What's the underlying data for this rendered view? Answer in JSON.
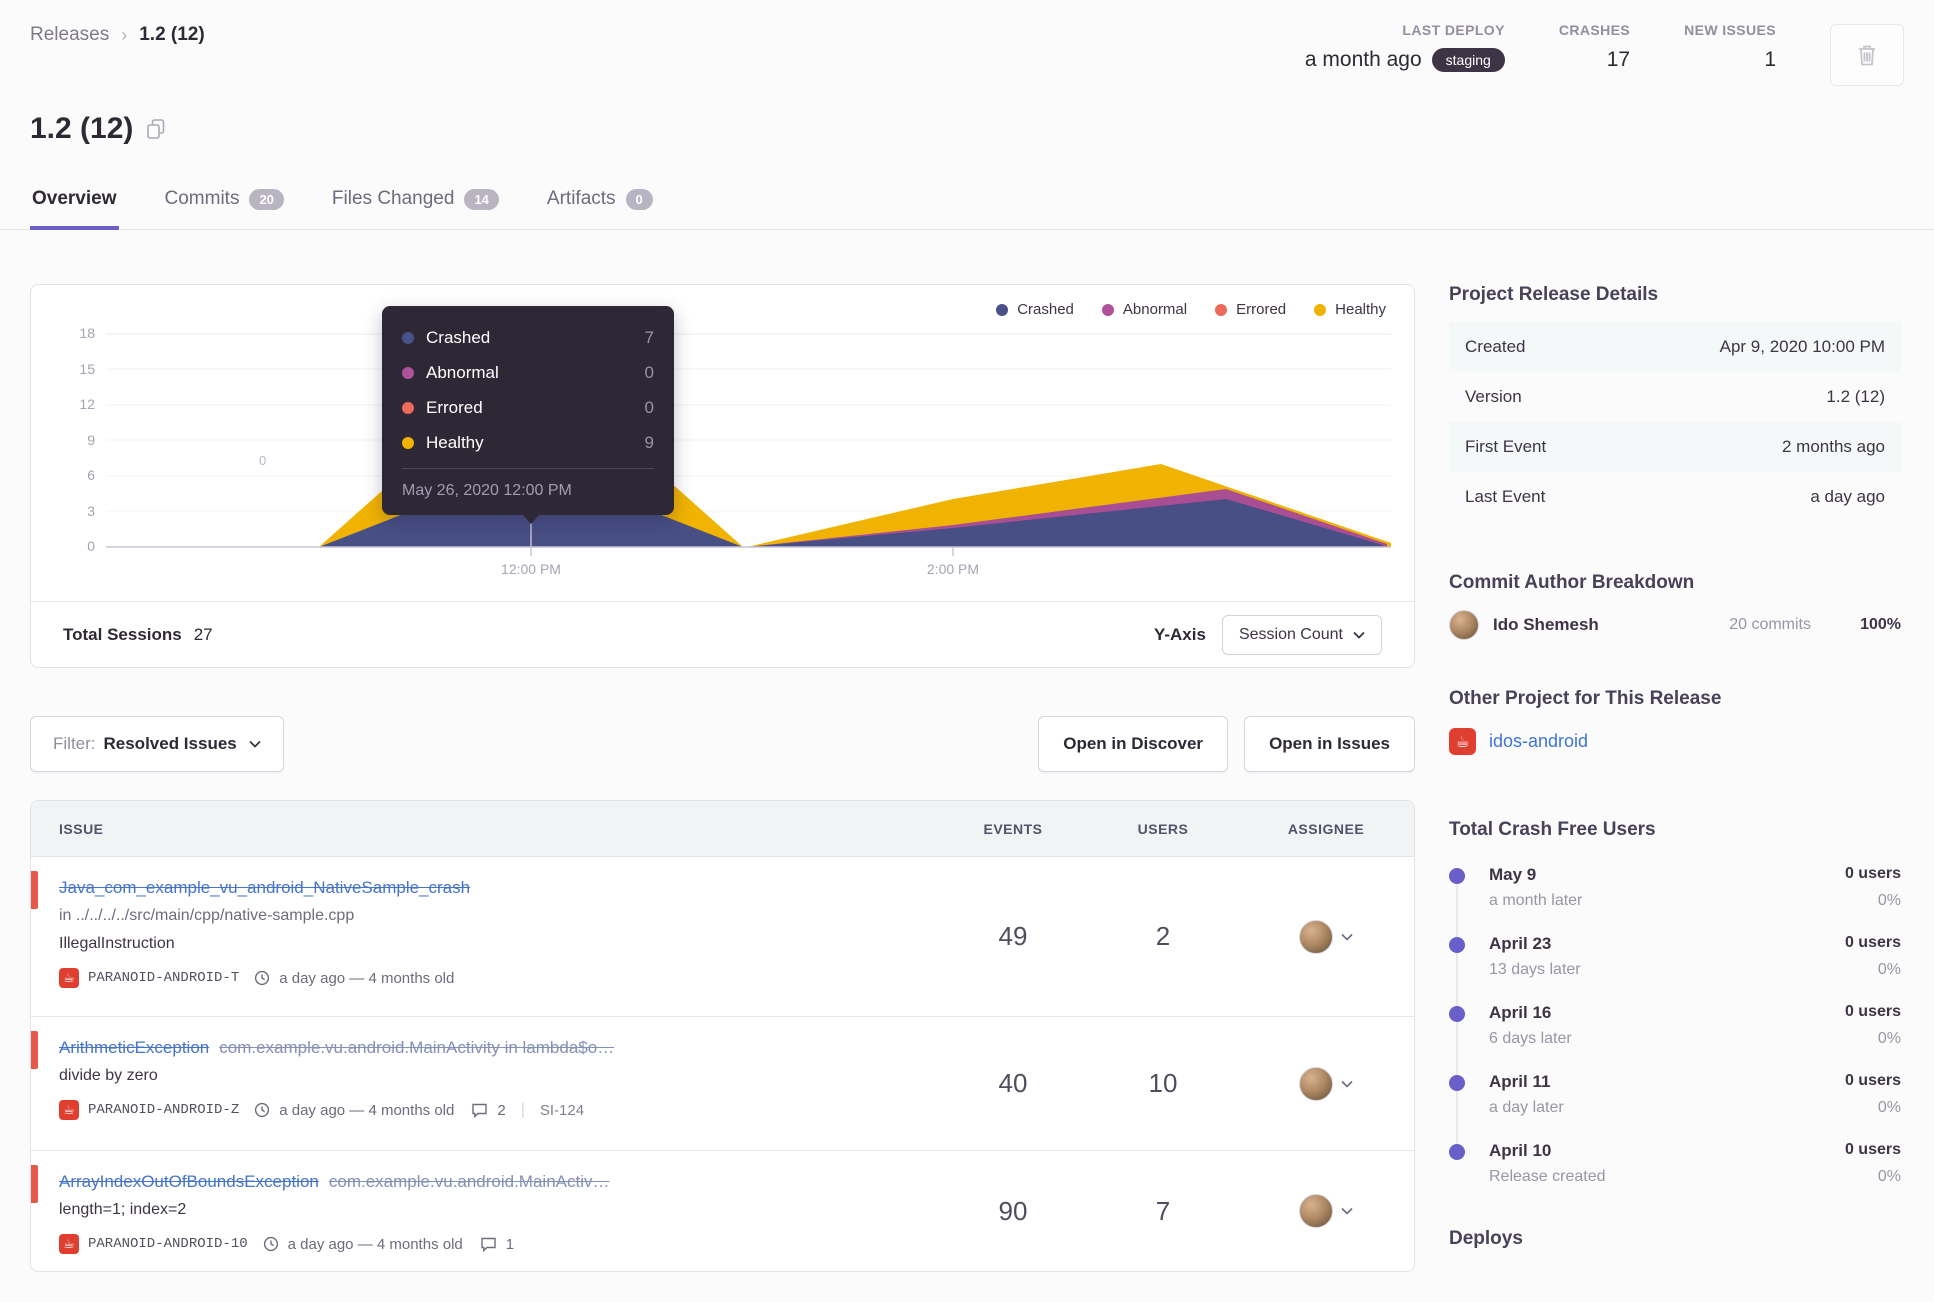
{
  "accent_color": "#6c5fc7",
  "breadcrumb": {
    "parent": "Releases",
    "current": "1.2 (12)"
  },
  "topstats": {
    "last_deploy": {
      "label": "LAST DEPLOY",
      "value": "a month ago",
      "env_badge": "staging"
    },
    "crashes": {
      "label": "CRASHES",
      "value": "17"
    },
    "new_issues": {
      "label": "NEW ISSUES",
      "value": "1"
    }
  },
  "title": "1.2 (12)",
  "tabs": [
    {
      "label": "Overview",
      "badge": null,
      "active": true
    },
    {
      "label": "Commits",
      "badge": "20"
    },
    {
      "label": "Files Changed",
      "badge": "14"
    },
    {
      "label": "Artifacts",
      "badge": "0"
    }
  ],
  "chart": {
    "legend": [
      {
        "label": "Crashed",
        "color": "#4a5088"
      },
      {
        "label": "Abnormal",
        "color": "#b0519c"
      },
      {
        "label": "Errored",
        "color": "#ec6a5a"
      },
      {
        "label": "Healthy",
        "color": "#f0b302"
      }
    ],
    "yticks": [
      "18",
      "15",
      "12",
      "9",
      "6",
      "3",
      "0"
    ],
    "xticks": [
      "12:00 PM",
      "2:00 PM"
    ],
    "faint_label": "0",
    "tooltip": {
      "rows": [
        {
          "label": "Crashed",
          "value": "7"
        },
        {
          "label": "Abnormal",
          "value": "0"
        },
        {
          "label": "Errored",
          "value": "0"
        },
        {
          "label": "Healthy",
          "value": "9"
        }
      ],
      "date": "May 26, 2020 12:00 PM"
    },
    "footer": {
      "total_label": "Total Sessions",
      "total_value": "27",
      "yaxis_label": "Y-Axis",
      "yaxis_value": "Session Count"
    }
  },
  "chart_data": {
    "type": "area",
    "stacked": true,
    "title": "Release sessions by status",
    "x": [
      "11:00 AM",
      "12:00 PM",
      "1:00 PM",
      "2:00 PM",
      "2:50 PM",
      "4:00 PM"
    ],
    "series": [
      {
        "name": "Crashed",
        "color": "#4a5088",
        "values": [
          0,
          7,
          0,
          2,
          4,
          0
        ]
      },
      {
        "name": "Abnormal",
        "color": "#b0519c",
        "values": [
          0,
          0,
          0,
          0,
          1,
          0
        ]
      },
      {
        "name": "Errored",
        "color": "#ec6a5a",
        "values": [
          0,
          0,
          0,
          0,
          0,
          0
        ]
      },
      {
        "name": "Healthy",
        "color": "#f0b302",
        "values": [
          0,
          9,
          0,
          3,
          3,
          0
        ]
      }
    ],
    "highlighted_point": {
      "x": "May 26, 2020 12:00 PM",
      "Crashed": 7,
      "Abnormal": 0,
      "Errored": 0,
      "Healthy": 9
    },
    "total_sessions": 27,
    "ylim": [
      0,
      18
    ],
    "ytick_step": 3,
    "legend_position": "top-right",
    "grid": true
  },
  "filter_bar": {
    "filter_label": "Filter:",
    "filter_value": "Resolved Issues",
    "actions": [
      {
        "label": "Open in Discover"
      },
      {
        "label": "Open in Issues"
      }
    ]
  },
  "issues": {
    "columns": [
      "ISSUE",
      "EVENTS",
      "USERS",
      "ASSIGNEE"
    ],
    "rows": [
      {
        "title": "Java_com_example_vu_android_NativeSample_crash",
        "title2": "",
        "subtitle": "in ../../../../src/main/cpp/native-sample.cpp",
        "culprit": "IllegalInstruction",
        "project": "PARANOID-ANDROID-T",
        "age": "a day ago — 4 months old",
        "comments": "",
        "short_id": "",
        "events": "49",
        "users": "2"
      },
      {
        "title": "ArithmeticException",
        "title2": "com.example.vu.android.MainActivity in lambda$o…",
        "subtitle": "",
        "culprit": "divide by zero",
        "project": "PARANOID-ANDROID-Z",
        "age": "a day ago — 4 months old",
        "comments": "2",
        "short_id": "SI-124",
        "events": "40",
        "users": "10"
      },
      {
        "title": "ArrayIndexOutOfBoundsException",
        "title2": "com.example.vu.android.MainActiv…",
        "subtitle": "",
        "culprit": "length=1; index=2",
        "project": "PARANOID-ANDROID-10",
        "age": "a day ago — 4 months old",
        "comments": "1",
        "short_id": "",
        "events": "90",
        "users": "7"
      }
    ]
  },
  "sidebar": {
    "details": {
      "title": "Project Release Details",
      "rows": [
        {
          "label": "Created",
          "value": "Apr 9, 2020 10:00 PM"
        },
        {
          "label": "Version",
          "value": "1.2 (12)"
        },
        {
          "label": "First Event",
          "value": "2 months ago"
        },
        {
          "label": "Last Event",
          "value": "a day ago"
        }
      ]
    },
    "commits": {
      "title": "Commit Author Breakdown",
      "author": {
        "name": "Ido Shemesh",
        "commits": "20 commits",
        "percent": "100%"
      }
    },
    "other_project": {
      "title": "Other Project for This Release",
      "link": "idos-android"
    },
    "crash_free": {
      "title": "Total Crash Free Users",
      "items": [
        {
          "date": "May 9",
          "sub": "a month later",
          "users": "0 users",
          "percent": "0%"
        },
        {
          "date": "April 23",
          "sub": "13 days later",
          "users": "0 users",
          "percent": "0%"
        },
        {
          "date": "April 16",
          "sub": "6 days later",
          "users": "0 users",
          "percent": "0%"
        },
        {
          "date": "April 11",
          "sub": "a day later",
          "users": "0 users",
          "percent": "0%"
        },
        {
          "date": "April 10",
          "sub": "Release created",
          "users": "0 users",
          "percent": "0%"
        }
      ]
    },
    "deploys_title": "Deploys"
  }
}
